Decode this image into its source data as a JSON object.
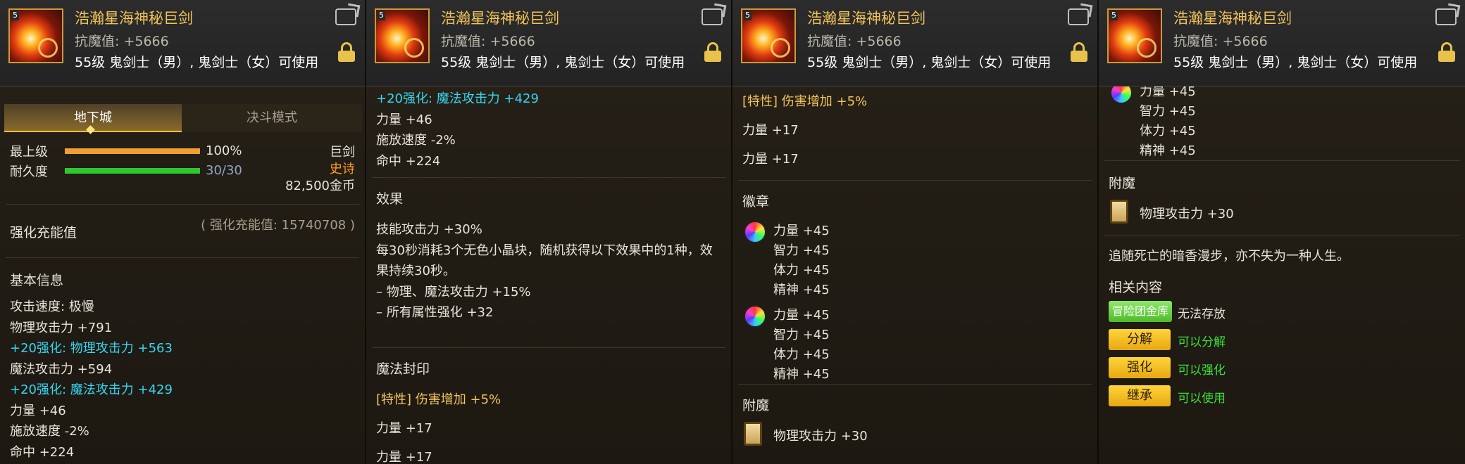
{
  "item": {
    "name": "浩瀚星海神秘巨剑",
    "resist": "抗魔值: +5666",
    "requirement": "55级 鬼剑士（男）, 鬼剑士（女）可使用",
    "thumb_tag": "5"
  },
  "panel1": {
    "tab_dungeon": "地下城",
    "tab_duel": "决斗模式",
    "grade_label": "最上级",
    "grade_value": "100%",
    "grade_fraction": 1.0,
    "durability_label": "耐久度",
    "durability_value": "30/30",
    "durability_fraction": 1.0,
    "weapon_type": "巨剑",
    "rarity": "史诗",
    "price": "82,500金币",
    "charge_label": "强化充能值",
    "charge_value": "( 强化充能值: 15740708 )",
    "basic_info_title": "基本信息",
    "stats": [
      {
        "text": "攻击速度: 极慢",
        "color": "white"
      },
      {
        "text": "物理攻击力 +791",
        "color": "white"
      },
      {
        "text": "+20强化: 物理攻击力 +563",
        "color": "cyan"
      },
      {
        "text": "魔法攻击力 +594",
        "color": "white"
      },
      {
        "text": "+20强化: 魔法攻击力 +429",
        "color": "cyan"
      },
      {
        "text": "力量 +46",
        "color": "white"
      },
      {
        "text": "施放速度 -2%",
        "color": "white"
      },
      {
        "text": "命中 +224",
        "color": "white"
      }
    ]
  },
  "panel2": {
    "top_lines": [
      {
        "text": "+20强化: 魔法攻击力 +429",
        "color": "cyan"
      },
      {
        "text": "力量 +46",
        "color": "white"
      },
      {
        "text": "施放速度 -2%",
        "color": "white"
      },
      {
        "text": "命中 +224",
        "color": "white"
      }
    ],
    "effect_title": "效果",
    "effect_lines": [
      "技能攻击力 +30%",
      "每30秒消耗3个无色小晶块，随机获得以下效果中的1种，效",
      "果持续30秒。",
      " – 物理、魔法攻击力 +15%",
      " – 所有属性强化 +32"
    ],
    "seal_title": "魔法封印",
    "seal_lines": [
      {
        "text": "[特性] 伤害增加 +5%",
        "color": "gold"
      },
      {
        "text": "力量 +17",
        "color": "white"
      },
      {
        "text": "力量 +17",
        "color": "white"
      }
    ]
  },
  "panel3": {
    "seal_lines": [
      {
        "text": "[特性] 伤害增加 +5%",
        "color": "gold"
      },
      {
        "text": "力量 +17",
        "color": "white"
      },
      {
        "text": "力量 +17",
        "color": "white"
      }
    ],
    "emblem_title": "徽章",
    "emblem1": [
      "力量 +45",
      "智力 +45",
      "体力 +45",
      "精神 +45"
    ],
    "emblem2": [
      "力量 +45",
      "智力 +45",
      "体力 +45",
      "精神 +45"
    ],
    "enchant_title": "附魔",
    "enchant_value": "物理攻击力 +30"
  },
  "panel4": {
    "emblem_lines": [
      "力量 +45",
      "智力 +45",
      "体力 +45",
      "精神 +45"
    ],
    "enchant_title": "附魔",
    "enchant_value": "物理攻击力 +30",
    "flavor": "追随死亡的暗香漫步，亦不失为一种人生。",
    "related_title": "相关内容",
    "related": [
      {
        "button": "冒险团金库",
        "note": "无法存放",
        "note_color": "white",
        "style": "green-btn"
      },
      {
        "button": "分解",
        "note": "可以分解",
        "note_color": "green",
        "style": ""
      },
      {
        "button": "强化",
        "note": "可以强化",
        "note_color": "green",
        "style": ""
      },
      {
        "button": "继承",
        "note": "可以使用",
        "note_color": "green",
        "style": ""
      }
    ]
  },
  "colors": {
    "name": "#f2c458",
    "cyan": "#36d6f0",
    "green": "#3adf3a",
    "epic": "#ff9d1e",
    "grade_bar": "#f0a030",
    "durability_bar": "#2ec82e"
  }
}
